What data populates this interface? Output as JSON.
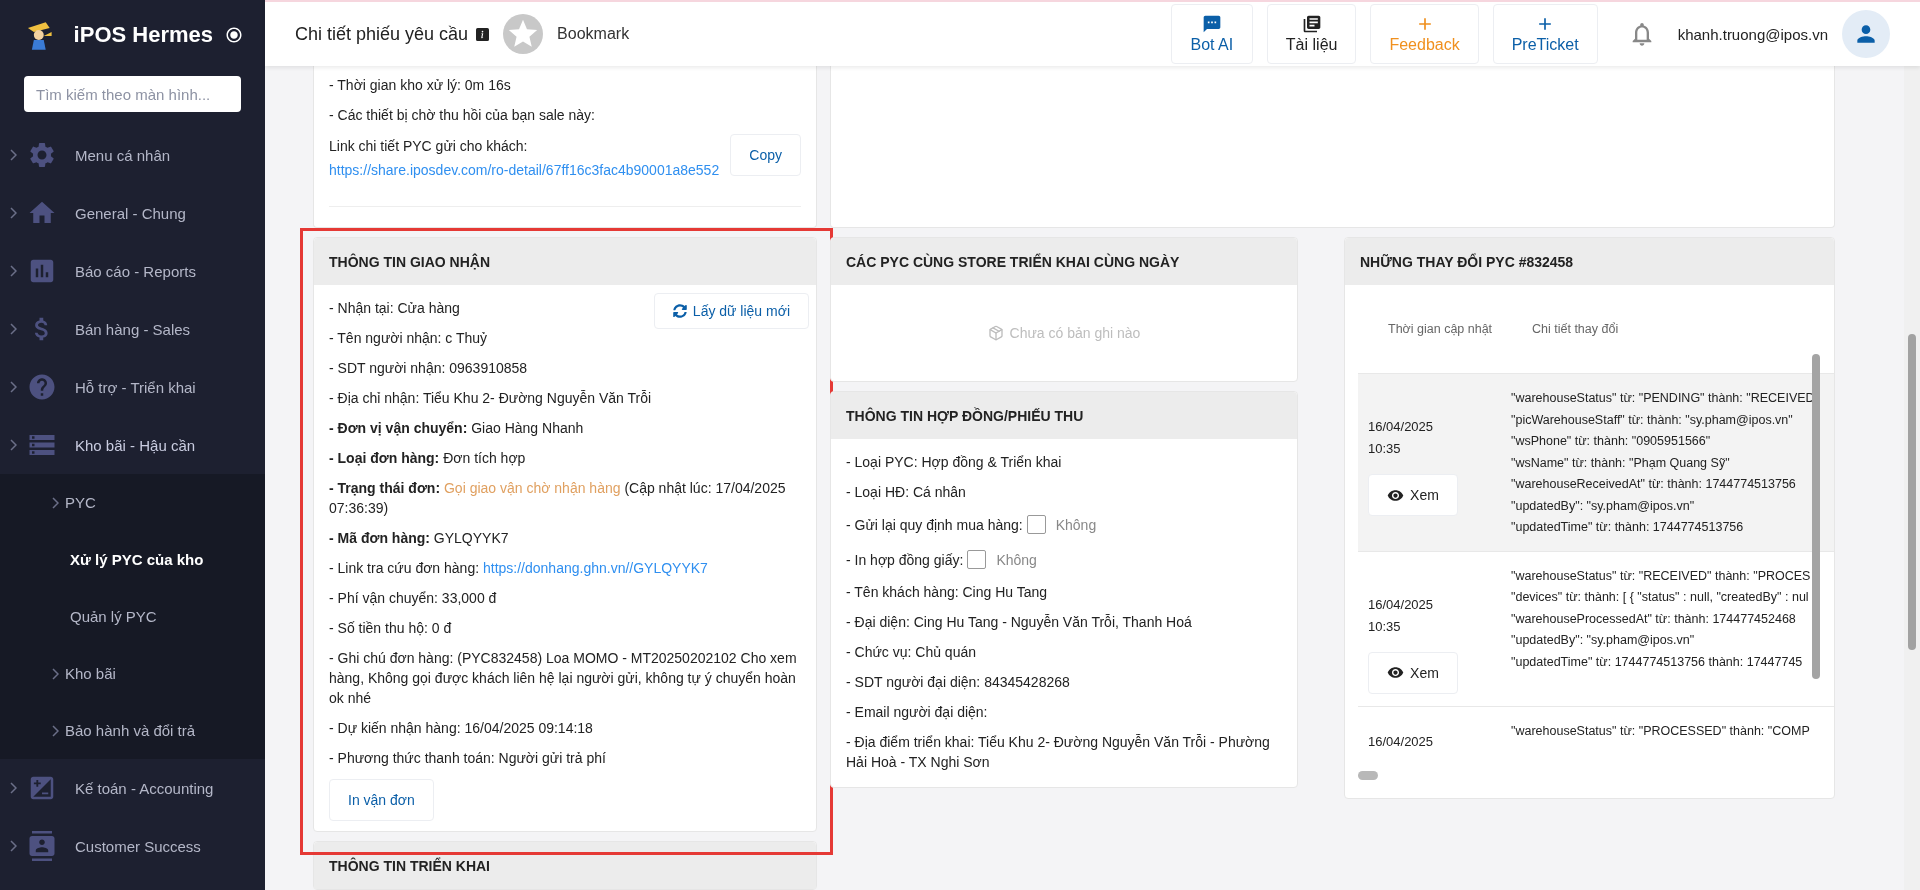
{
  "sidebar": {
    "brand": "iPOS Hermes",
    "search": {
      "placeholder": "Tìm kiếm theo màn hình..."
    },
    "items": [
      {
        "label": "Menu cá nhân",
        "expanded": false,
        "selected": false
      },
      {
        "label": "General - Chung",
        "expanded": false,
        "selected": false
      },
      {
        "label": "Báo cáo - Reports",
        "expanded": false,
        "selected": false
      },
      {
        "label": "Bán hàng - Sales",
        "expanded": false,
        "selected": false
      },
      {
        "label": "Hỗ trợ - Triển khai",
        "expanded": false,
        "selected": false
      },
      {
        "label": "Kho bãi - Hậu cần",
        "expanded": true,
        "selected": false,
        "children": [
          {
            "label": "PYC",
            "expandable": true,
            "selected": false
          },
          {
            "label": "Xử lý PYC của kho",
            "expandable": false,
            "selected": true
          },
          {
            "label": "Quản lý PYC",
            "expandable": false,
            "selected": false
          },
          {
            "label": "Kho bãi",
            "expandable": true,
            "selected": false
          },
          {
            "label": "Bảo hành và đổi trả",
            "expandable": true,
            "selected": false
          }
        ]
      },
      {
        "label": "Kế toán - Accounting",
        "expanded": false,
        "selected": false
      },
      {
        "label": "Customer Success",
        "expanded": false,
        "selected": false
      }
    ]
  },
  "header": {
    "title": "Chi tiết phiếu yêu cầu",
    "bookmark": "Bookmark",
    "buttons": [
      {
        "label": "Bot AI",
        "color": "#0b5fa8"
      },
      {
        "label": "Tài liệu",
        "color": "#222222"
      },
      {
        "label": "Feedback",
        "color": "#f0901e"
      },
      {
        "label": "PreTicket",
        "color": "#0b5fa8"
      }
    ],
    "user": "khanh.truong@ipos.vn"
  },
  "summary_card": {
    "lines": [
      "- Thời gian kho xử lý: 0m 16s",
      "- Các thiết bị chờ thu hồi của bạn sale này:"
    ],
    "link_label": "Link chi tiết PYC gửi cho khách:",
    "link": "https://share.iposdev.com/ro-detail/67ff16c3fac4b90001a8e552",
    "copy_button": "Copy"
  },
  "delivery": {
    "title": "THÔNG TIN GIAO NHẬN",
    "refresh_button": "Lấy dữ liệu mới",
    "lines": [
      {
        "text": "- Nhận tại: Cửa hàng"
      },
      {
        "text": "- Tên người nhận: c Thuỷ"
      },
      {
        "text": "- SDT người nhận: 0963910858"
      },
      {
        "text": "- Địa chỉ nhận: Tiểu Khu 2- Đường Nguyễn Văn Trỗi"
      },
      {
        "text": "**- Đơn vị vận chuyển:** Giao Hàng Nhanh"
      },
      {
        "text": "**- Loại đơn hàng:** Đơn tích hợp"
      },
      {
        "text": "**- Trạng thái đơn:**",
        "status": "Gọi giao vận chờ nhận hàng",
        "after": "(Cập nhật lúc: 17/04/2025 07:36:39)"
      },
      {
        "text": "**- Mã đơn hàng:** GYLQYYK7"
      },
      {
        "text": "- Link tra cứu đơn hàng:",
        "link": "https://donhang.ghn.vn//GYLQYYK7"
      },
      {
        "text": "- Phí vận chuyển: 33,000 đ"
      },
      {
        "text": "- Số tiền thu hộ: 0 đ"
      },
      {
        "text": "- Ghi chú đơn hàng: (PYC832458) Loa MOMO - MT20250202102 Cho xem hàng, Không gọi được khách liên hệ lại người gửi, không tự ý chuyển hoàn ok nhé"
      },
      {
        "text": "- Dự kiến nhận hàng: 16/04/2025 09:14:18"
      },
      {
        "text": "- Phương thức thanh toán: Người gửi trả phí"
      }
    ],
    "print_button": "In vận đơn"
  },
  "same_day": {
    "title": "CÁC PYC CÙNG STORE TRIỂN KHAI CÙNG NGÀY",
    "empty": "Chưa có bản ghi nào"
  },
  "contract": {
    "title": "THÔNG TIN HỢP ĐỒNG/PHIẾU THU",
    "lines": [
      {
        "kind": "text",
        "text": "- Loại PYC: Hợp đồng & Triển khai"
      },
      {
        "kind": "text",
        "text": "- Loại HĐ: Cá nhân"
      },
      {
        "kind": "checkbox",
        "text": "- Gửi lại quy định mua hàng:",
        "checked": false,
        "option": "Không"
      },
      {
        "kind": "checkbox",
        "text": "- In hợp đồng giấy:",
        "checked": false,
        "option": "Không"
      },
      {
        "kind": "text",
        "text": "- Tên khách hàng: Cing Hu Tang"
      },
      {
        "kind": "text",
        "text": "- Đại diện: Cing Hu Tang - Nguyễn Văn Trỗi, Thanh Hoá"
      },
      {
        "kind": "text",
        "text": "- Chức vụ: Chủ quán"
      },
      {
        "kind": "text",
        "text": "- SDT người đại diện: 84345428268"
      },
      {
        "kind": "text",
        "text": "- Email người đại diện:"
      },
      {
        "kind": "text",
        "text": "- Địa điểm triển khai: Tiểu Khu 2- Đường Nguyễn Văn Trỗi - Phường Hải Hoà - TX Nghi Sơn"
      }
    ]
  },
  "history": {
    "title": "NHỮNG THAY ĐỔI PYC #832458",
    "columns": [
      "Thời gian cập nhật",
      "Chi tiết thay đổi"
    ],
    "rows": [
      {
        "date": "16/04/2025",
        "time": "10:35",
        "button": "Xem",
        "selected": true,
        "changes": [
          "\"warehouseStatus\" từ: \"PENDING\" thành: \"RECEIVED",
          "\"picWarehouseStaff\" từ: thành: \"sy.pham@ipos.vn\"",
          "\"wsPhone\" từ: thành: \"0905951566\"",
          "\"wsName\" từ: thành: \"Phạm Quang Sỹ\"",
          "\"warehouseReceivedAt\" từ: thành: 1744774513756",
          "\"updatedBy\": \"sy.pham@ipos.vn\"",
          "\"updatedTime\" từ: thành: 1744774513756"
        ]
      },
      {
        "date": "16/04/2025",
        "time": "10:35",
        "button": "Xem",
        "selected": false,
        "changes": [
          "\"warehouseStatus\" từ: \"RECEIVED\" thành: \"PROCES",
          "\"devices\" từ: thành: [ { \"status\" : null, \"createdBy\" : nul",
          "\"warehouseProcessedAt\" từ: thành: 174477452468",
          "\"updatedBy\": \"sy.pham@ipos.vn\"",
          "\"updatedTime\" từ: 1744774513756 thành: 17447745"
        ]
      },
      {
        "date": "16/04/2025",
        "selected": false,
        "changes": [
          "\"warehouseStatus\" từ: \"PROCESSED\" thành: \"COMP"
        ]
      }
    ]
  },
  "next_section": {
    "title": "THÔNG TIN TRIỂN KHAI"
  }
}
